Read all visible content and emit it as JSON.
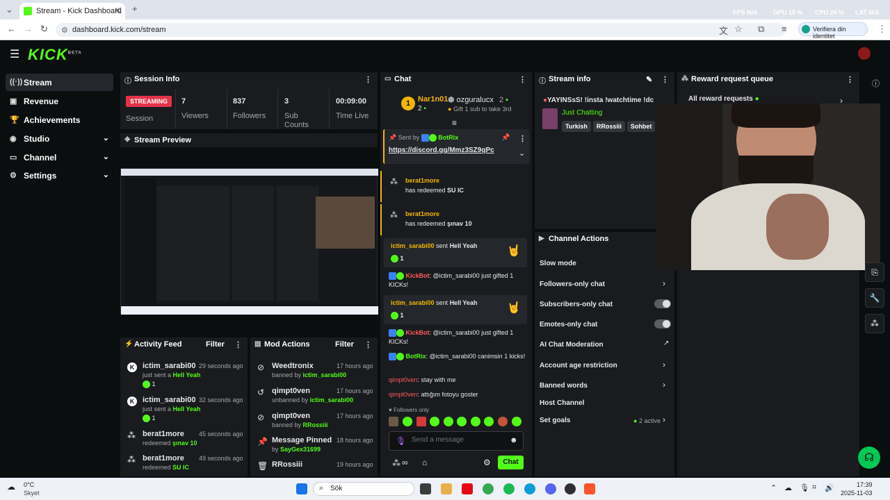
{
  "browser": {
    "tab_title": "Stream - Kick Dashboard",
    "url": "dashboard.kick.com/stream",
    "identity_label": "Verifiera din identitet",
    "stats": {
      "fps": "FPS N/A",
      "gpu": "GPU 15 %",
      "cpu": "CPU 24 %",
      "lat": "LAT N/A"
    }
  },
  "kick": {
    "logo": "KICK",
    "logo_beta": "BETA"
  },
  "sidebar": {
    "items": [
      {
        "label": "Stream",
        "icon": "broadcast-icon"
      },
      {
        "label": "Revenue",
        "icon": "wallet-icon"
      },
      {
        "label": "Achievements",
        "icon": "trophy-icon"
      },
      {
        "label": "Studio",
        "icon": "studio-icon"
      },
      {
        "label": "Channel",
        "icon": "channel-icon"
      },
      {
        "label": "Settings",
        "icon": "gear-icon"
      }
    ]
  },
  "session": {
    "title": "Session Info",
    "status_badge": "STREAMING",
    "status_label": "Session",
    "viewers": "7",
    "viewers_label": "Viewers",
    "followers": "837",
    "followers_label": "Followers",
    "subs": "3",
    "subs_label": "Sub Counts",
    "time": "00:09:00",
    "time_label": "Time Live"
  },
  "preview": {
    "title": "Stream Preview"
  },
  "activity": {
    "title": "Activity Feed",
    "filter": "Filter",
    "items": [
      {
        "user": "ictim_sarabi00",
        "time": "29 seconds ago",
        "pre": "just sent a ",
        "what": "Hell Yeah",
        "count": "1"
      },
      {
        "user": "ictim_sarabi00",
        "time": "32 seconds ago",
        "pre": "just sent a ",
        "what": "Hell Yeah",
        "count": "1"
      },
      {
        "user": "berat1more",
        "time": "45 seconds ago",
        "pre": "redeemed ",
        "what": "şınav 10"
      },
      {
        "user": "berat1more",
        "time": "49 seconds ago",
        "pre": "redeemed ",
        "what": "SU IC"
      }
    ]
  },
  "modactions": {
    "title": "Mod Actions",
    "filter": "Filter",
    "items": [
      {
        "title": "Weedtronix",
        "time": "17 hours ago",
        "pre": "banned by ",
        "who": "ictim_sarabi00"
      },
      {
        "title": "qimpt0ven",
        "time": "17 hours ago",
        "pre": "unbanned by ",
        "who": "ictim_sarabi00"
      },
      {
        "title": "qimpt0ven",
        "time": "17 hours ago",
        "pre": "banned by ",
        "who": "RRossiii"
      },
      {
        "title": "Message Pinned",
        "time": "18 hours ago",
        "pre": "by ",
        "who": "SayGex31699"
      },
      {
        "title": "RRossiii",
        "time": "19 hours ago",
        "pre": "",
        "who": ""
      }
    ]
  },
  "chat": {
    "title": "Chat",
    "top_gifter": "Nar1n01",
    "top_gifter_count": "2",
    "top_rank": "1",
    "second_gifter": "ozguralucx",
    "second_count": "2",
    "gift_progress": "Gift 1 sub to take 3rd",
    "pinned_sent_by": "Sent by",
    "pinned_user": "BotRix",
    "pinned_link": "https://discord.gg/Mmz3SZ9qPc",
    "redeem1_user": "berat1more",
    "redeem1_text": "has redeemed ",
    "redeem1_item": "SU IC",
    "redeem2_user": "berat1more",
    "redeem2_text": "has redeemed ",
    "redeem2_item": "şınav 10",
    "kicks1_user": "ictim_sarabi00",
    "kicks1_text": " sent ",
    "kicks1_item": "Hell Yeah",
    "kicks1_count": "1",
    "bot1_user": "KickBot",
    "bot1_msg": ": @ictim_sarabi00 just gifted 1 KICKs!",
    "kicks2_user": "ictim_sarabi00",
    "kicks2_text": " sent ",
    "kicks2_item": "Hell Yeah",
    "kicks2_count": "1",
    "bot2_user": "KickBot",
    "bot2_msg": ": @ictim_sarabi00 just gifted 1 KICKs!",
    "bot3_user": "BotRix",
    "bot3_msg": ": @ictim_sarabi00 canimsin 1 kicks!",
    "msg1_user": "qimpt0ven",
    "msg1_text": ": stay with me",
    "msg2_user": "qimpt0ven",
    "msg2_text": ": attığım fotoyu goster",
    "followers_only": "Followers only",
    "input_placeholder": "Send a message",
    "send_label": "Chat"
  },
  "streaminfo": {
    "title": "Stream info",
    "stream_title": "YAYINSsS! !insta !watchtime !dc",
    "category": "Just Chatting",
    "tags": [
      "Turkish",
      "RRossiii",
      "Sohbet"
    ]
  },
  "channelactions": {
    "title": "Channel Actions",
    "items": [
      {
        "label": "Slow mode",
        "control": "none"
      },
      {
        "label": "Followers-only chat",
        "control": "chevron"
      },
      {
        "label": "Subscribers-only chat",
        "control": "toggle"
      },
      {
        "label": "Emotes-only chat",
        "control": "toggle"
      },
      {
        "label": "AI Chat Moderation",
        "control": "external"
      },
      {
        "label": "Account age restriction",
        "control": "chevron"
      },
      {
        "label": "Banned words",
        "control": "chevron"
      },
      {
        "label": "Host Channel",
        "control": "none"
      },
      {
        "label": "Set goals",
        "control": "chevron"
      }
    ],
    "goals_active": "2 active"
  },
  "rewards": {
    "title": "Reward request queue",
    "all_label": "All reward requests"
  },
  "taskbar": {
    "weather_temp": "0°C",
    "weather_desc": "Skyet",
    "search": "Sök",
    "time": "17:39",
    "date": "2025-11-03"
  },
  "colors": {
    "kick_green": "#53fc18",
    "panel": "#191b1f",
    "bg": "#0b0e0f",
    "streaming_red": "#e5334a"
  }
}
